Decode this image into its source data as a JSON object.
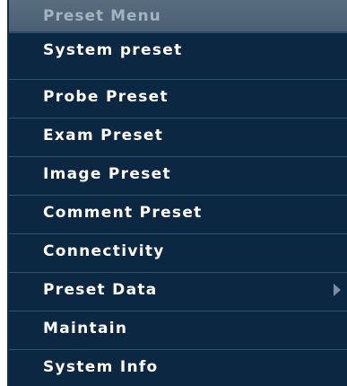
{
  "menu": {
    "title": "Preset Menu",
    "items": [
      {
        "label": "System preset",
        "submenu": false
      },
      {
        "label": "Probe Preset",
        "submenu": false
      },
      {
        "label": "Exam Preset",
        "submenu": false
      },
      {
        "label": "Image Preset",
        "submenu": false
      },
      {
        "label": "Comment Preset",
        "submenu": false
      },
      {
        "label": "Connectivity",
        "submenu": false
      },
      {
        "label": "Preset Data",
        "submenu": true
      },
      {
        "label": "Maintain",
        "submenu": false
      },
      {
        "label": "System Info",
        "submenu": false
      }
    ],
    "colors": {
      "background": "#0b2741",
      "header": "#4f6479",
      "header_text": "#a2b2c3",
      "item_text": "#ffffff",
      "separator": "#2f4f6b"
    },
    "icons": {
      "submenu": "triangle-right-icon"
    }
  }
}
